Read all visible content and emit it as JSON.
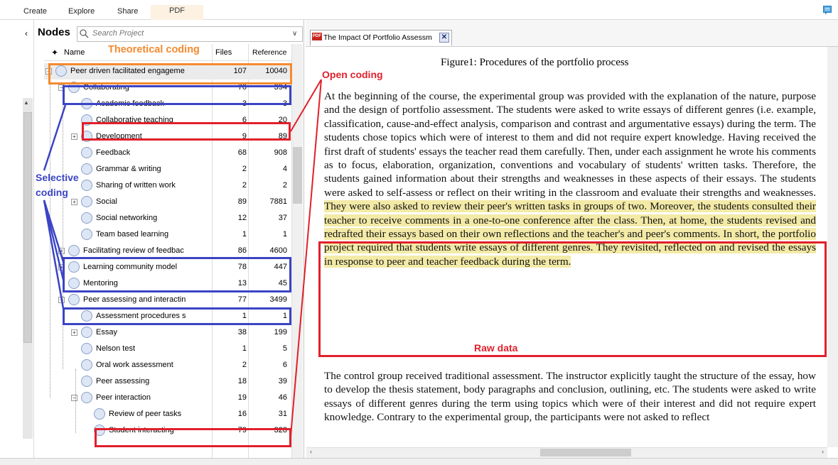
{
  "ribbon": {
    "tabs": [
      "Create",
      "Explore",
      "Share",
      "PDF"
    ]
  },
  "nodes_panel": {
    "title": "Nodes",
    "search_placeholder": "Search Project",
    "columns": {
      "name": "Name",
      "files": "Files",
      "references": "Reference"
    },
    "rows": [
      {
        "label": "Peer driven facilitated engageme",
        "files": "107",
        "refs": "10040",
        "level": 0,
        "expand": "−"
      },
      {
        "label": "Collaborating",
        "files": "70",
        "refs": "394",
        "level": 1,
        "expand": "−"
      },
      {
        "label": "Academic feedback",
        "files": "3",
        "refs": "3",
        "level": 2,
        "expand": ""
      },
      {
        "label": "Collaborative teaching",
        "files": "6",
        "refs": "20",
        "level": 2,
        "expand": ""
      },
      {
        "label": "Development",
        "files": "9",
        "refs": "89",
        "level": 2,
        "expand": "+"
      },
      {
        "label": "Feedback",
        "files": "68",
        "refs": "908",
        "level": 2,
        "expand": ""
      },
      {
        "label": "Grammar & writing",
        "files": "2",
        "refs": "4",
        "level": 2,
        "expand": ""
      },
      {
        "label": "Sharing of written work",
        "files": "2",
        "refs": "2",
        "level": 2,
        "expand": ""
      },
      {
        "label": "Social",
        "files": "89",
        "refs": "7881",
        "level": 2,
        "expand": "+"
      },
      {
        "label": "Social networking",
        "files": "12",
        "refs": "37",
        "level": 2,
        "expand": ""
      },
      {
        "label": "Team based learning",
        "files": "1",
        "refs": "1",
        "level": 2,
        "expand": ""
      },
      {
        "label": "Facilitating review of feedbac",
        "files": "86",
        "refs": "4600",
        "level": 1,
        "expand": "+"
      },
      {
        "label": "Learning community model",
        "files": "78",
        "refs": "447",
        "level": 1,
        "expand": "+"
      },
      {
        "label": "Mentoring",
        "files": "13",
        "refs": "45",
        "level": 1,
        "expand": ""
      },
      {
        "label": "Peer assessing and interactin",
        "files": "77",
        "refs": "3499",
        "level": 1,
        "expand": "−"
      },
      {
        "label": "Assessment procedures s",
        "files": "1",
        "refs": "1",
        "level": 2,
        "expand": ""
      },
      {
        "label": "Essay",
        "files": "38",
        "refs": "199",
        "level": 2,
        "expand": "+"
      },
      {
        "label": "Nelson test",
        "files": "1",
        "refs": "5",
        "level": 2,
        "expand": ""
      },
      {
        "label": "Oral work assessment",
        "files": "2",
        "refs": "6",
        "level": 2,
        "expand": ""
      },
      {
        "label": "Peer assessing",
        "files": "18",
        "refs": "39",
        "level": 2,
        "expand": ""
      },
      {
        "label": "Peer interaction",
        "files": "19",
        "refs": "46",
        "level": 2,
        "expand": "−"
      },
      {
        "label": "Review of peer tasks",
        "files": "16",
        "refs": "31",
        "level": 3,
        "expand": ""
      },
      {
        "label": "Student interacting",
        "files": "79",
        "refs": "328",
        "level": 3,
        "expand": ""
      }
    ]
  },
  "annotations": {
    "theoretical": "Theoretical coding",
    "open": "Open coding",
    "selective_1": "Selective",
    "selective_2": "coding",
    "raw": "Raw data"
  },
  "document": {
    "tab_title": "The Impact Of Portfolio Assessm",
    "pdf_badge": "PDF",
    "figure_caption": "Figure1: Procedures of the portfolio process",
    "para1_plain": "At the beginning of the course, the experimental group was provided with the explanation of the nature, purpose and the design of portfolio assessment. The students were asked to write essays of different genres (i.e. example, classification, cause-and-effect analysis, comparison and contrast and argumentative essays) during the term. The students chose topics which were of interest to them and did not require expert knowledge. Having received the first draft of students' essays the teacher read them carefully. Then, under each assignment he wrote his comments as to focus, elaboration, organization, conventions and vocabulary of students' written tasks. Therefore, the students gained information about their strengths and weaknesses in these aspects of their essays. The students were asked to self-assess or reflect on their writing in the classroom and evaluate their strengths and weaknesses. ",
    "para1_highlight": "They were also asked to review their peer's written tasks in groups of two. Moreover, the students consulted their teacher to receive comments in a one-to-one conference after the class. Then, at home, the students revised and redrafted their essays based on their own reflections and the teacher's and peer's comments. In short, the portfolio project required that students write essays of different genres. They revisited, reflected on and revised the essays in response to peer and teacher feedback during the term.",
    "para2": "The control group received traditional assessment. The instructor explicitly taught the structure of the essay, how to develop the thesis statement, body paragraphs and conclusion, outlining, etc. The students were asked to write essays of different genres during the term using topics which were of their interest and did not require expert knowledge. Contrary to the experimental group, the participants were not asked to reflect"
  },
  "colors": {
    "theoretical": "#f58a2e",
    "open": "#e1202b",
    "selective": "#3b44c4",
    "highlight": "#f3eaa7"
  }
}
